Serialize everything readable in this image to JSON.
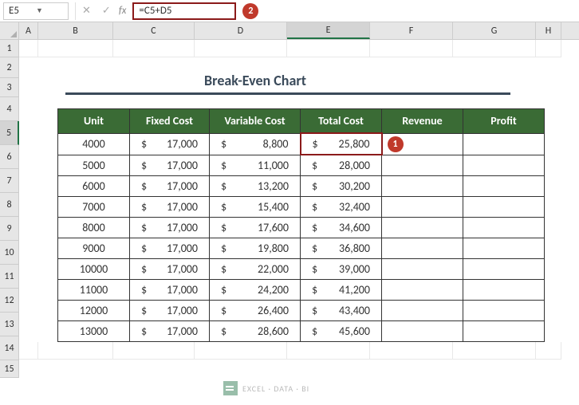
{
  "name_box": "E5",
  "formula": "=C5+D5",
  "fx_label": "fx",
  "callout_1": "1",
  "callout_2": "2",
  "columns": [
    "A",
    "B",
    "C",
    "D",
    "E",
    "F",
    "G",
    "H"
  ],
  "row_nums": [
    "1",
    "2",
    "3",
    "4",
    "5",
    "6",
    "7",
    "8",
    "9",
    "10",
    "11",
    "12",
    "13",
    "14",
    "15"
  ],
  "title": "Break-Even Chart",
  "headers": {
    "unit": "Unit",
    "fixed_cost": "Fixed Cost",
    "variable_cost": "Variable Cost",
    "total_cost": "Total Cost",
    "revenue": "Revenue",
    "profit": "Profit"
  },
  "currency": "$",
  "rows": [
    {
      "unit": "4000",
      "fc": "17,000",
      "vc": "8,800",
      "tc": "25,800",
      "rev": "",
      "prof": ""
    },
    {
      "unit": "5000",
      "fc": "17,000",
      "vc": "11,000",
      "tc": "28,000",
      "rev": "",
      "prof": ""
    },
    {
      "unit": "6000",
      "fc": "17,000",
      "vc": "13,200",
      "tc": "30,200",
      "rev": "",
      "prof": ""
    },
    {
      "unit": "7000",
      "fc": "17,000",
      "vc": "15,400",
      "tc": "32,400",
      "rev": "",
      "prof": ""
    },
    {
      "unit": "8000",
      "fc": "17,000",
      "vc": "17,600",
      "tc": "34,600",
      "rev": "",
      "prof": ""
    },
    {
      "unit": "9000",
      "fc": "17,000",
      "vc": "19,800",
      "tc": "36,800",
      "rev": "",
      "prof": ""
    },
    {
      "unit": "10000",
      "fc": "17,000",
      "vc": "22,000",
      "tc": "39,000",
      "rev": "",
      "prof": ""
    },
    {
      "unit": "11000",
      "fc": "17,000",
      "vc": "24,200",
      "tc": "41,200",
      "rev": "",
      "prof": ""
    },
    {
      "unit": "12000",
      "fc": "17,000",
      "vc": "26,400",
      "tc": "43,400",
      "rev": "",
      "prof": ""
    },
    {
      "unit": "13000",
      "fc": "17,000",
      "vc": "28,600",
      "tc": "45,600",
      "rev": "",
      "prof": ""
    }
  ],
  "watermark": "EXCEL · DATA · BI",
  "chart_data": {
    "type": "table",
    "title": "Break-Even Chart",
    "columns": [
      "Unit",
      "Fixed Cost",
      "Variable Cost",
      "Total Cost",
      "Revenue",
      "Profit"
    ],
    "data": [
      [
        4000,
        17000,
        8800,
        25800,
        null,
        null
      ],
      [
        5000,
        17000,
        11000,
        28000,
        null,
        null
      ],
      [
        6000,
        17000,
        13200,
        30200,
        null,
        null
      ],
      [
        7000,
        17000,
        15400,
        32400,
        null,
        null
      ],
      [
        8000,
        17000,
        17600,
        34600,
        null,
        null
      ],
      [
        9000,
        17000,
        19800,
        36800,
        null,
        null
      ],
      [
        10000,
        17000,
        22000,
        39000,
        null,
        null
      ],
      [
        11000,
        17000,
        24200,
        41200,
        null,
        null
      ],
      [
        12000,
        17000,
        26400,
        43400,
        null,
        null
      ],
      [
        13000,
        17000,
        28600,
        45600,
        null,
        null
      ]
    ]
  }
}
